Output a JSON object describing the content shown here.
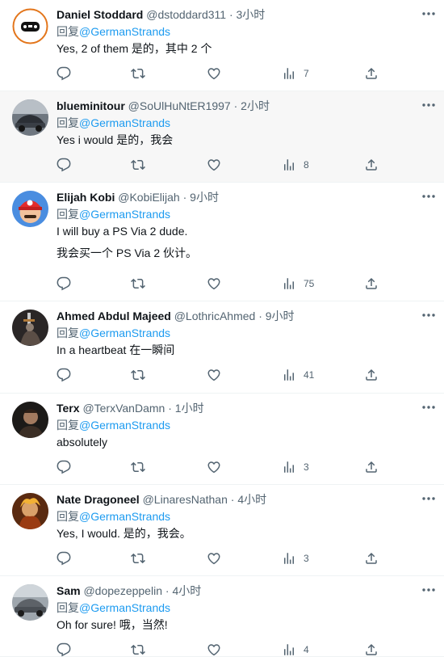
{
  "replies": [
    {
      "name": "Daniel Stoddard",
      "handle": "@dstoddard311",
      "time": "3小时",
      "reply_prefix": "回复",
      "reply_to": "@GermanStrands",
      "text": "Yes, 2 of them 是的，其中 2 个",
      "text2": "",
      "views": "7",
      "shaded": false,
      "avatar": "controller-logo"
    },
    {
      "name": "blueminitour",
      "handle": "@SoUlHuNtER1997",
      "time": "2小时",
      "reply_prefix": "回复",
      "reply_to": "@GermanStrands",
      "text": "Yes i would 是的，我会",
      "text2": "",
      "views": "8",
      "shaded": true,
      "avatar": "car-photo"
    },
    {
      "name": "Elijah Kobi",
      "handle": "@KobiElijah",
      "time": "9小时",
      "reply_prefix": "回复",
      "reply_to": "@GermanStrands",
      "text": "I will buy a PS Via 2 dude.",
      "text2": "我会买一个 PS Via 2 伙计。",
      "views": "75",
      "shaded": false,
      "avatar": "mario"
    },
    {
      "name": "Ahmed Abdul Majeed",
      "handle": "@LothricAhmed",
      "time": "9小时",
      "reply_prefix": "回复",
      "reply_to": "@GermanStrands",
      "text": "In a heartbeat 在一瞬间",
      "text2": "",
      "views": "41",
      "shaded": false,
      "avatar": "knight-art"
    },
    {
      "name": "Terx",
      "handle": "@TerxVanDamn",
      "time": "1小时",
      "reply_prefix": "回复",
      "reply_to": "@GermanStrands",
      "text": "absolutely",
      "text2": "",
      "views": "3",
      "shaded": false,
      "avatar": "dark-portrait"
    },
    {
      "name": "Nate Dragoneel",
      "handle": "@LinaresNathan",
      "time": "4小时",
      "reply_prefix": "回复",
      "reply_to": "@GermanStrands",
      "text": "Yes, I would. 是的，我会。",
      "text2": "",
      "views": "3",
      "shaded": false,
      "avatar": "fire-character"
    },
    {
      "name": "Sam",
      "handle": "@dopezeppelin",
      "time": "4小时",
      "reply_prefix": "回复",
      "reply_to": "@GermanStrands",
      "text": "Oh for sure! 哦，当然!",
      "text2": "",
      "views": "4",
      "shaded": false,
      "avatar": "grey-car"
    }
  ],
  "icons": {
    "reply": "comment-icon",
    "retweet": "retweet-icon",
    "like": "heart-icon",
    "views": "views-chart-icon",
    "share": "share-icon",
    "more": "more-dots-icon"
  },
  "colors": {
    "text": "#0f1419",
    "muted": "#536471",
    "link": "#1d9bf0",
    "border": "#eff3f4",
    "shaded_bg": "#f7f7f7"
  }
}
